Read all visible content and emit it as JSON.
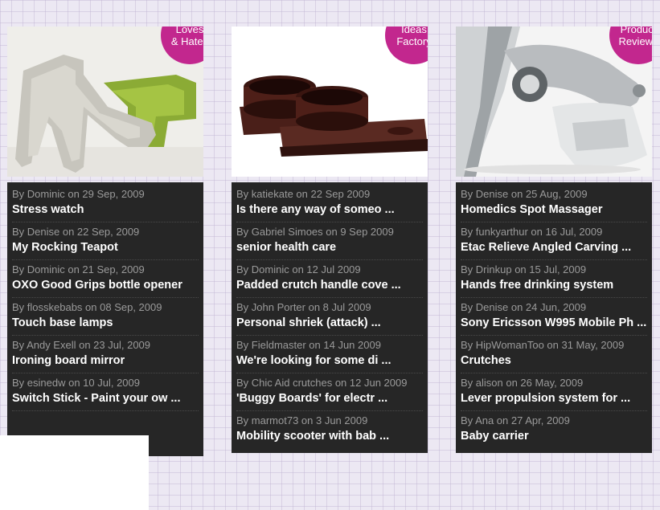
{
  "columns": [
    {
      "badge": [
        "Loves",
        "& Hates"
      ],
      "image_alt": "lounge chair",
      "items": [
        {
          "meta": "By Dominic on 29 Sep, 2009",
          "title": "Stress watch"
        },
        {
          "meta": "By Denise on 22 Sep, 2009",
          "title": "My Rocking Teapot"
        },
        {
          "meta": "By Dominic on 21 Sep, 2009",
          "title": "OXO Good Grips bottle opener"
        },
        {
          "meta": "By flosskebabs on 08 Sep, 2009",
          "title": "Touch base lamps"
        },
        {
          "meta": "By Andy Exell on 23 Jul, 2009",
          "title": "Ironing board mirror"
        },
        {
          "meta": "By esinedw on 10 Jul, 2009",
          "title": "Switch Stick - Paint your ow ..."
        }
      ]
    },
    {
      "badge": [
        "Ideas",
        "Factory"
      ],
      "image_alt": "brown cups on tray",
      "items": [
        {
          "meta": "By katiekate on 22 Sep 2009",
          "title": "Is there any way of someo ..."
        },
        {
          "meta": "By Gabriel Simoes on 9 Sep 2009",
          "title": "senior health care"
        },
        {
          "meta": "By Dominic on 12 Jul 2009",
          "title": "Padded crutch handle cove ..."
        },
        {
          "meta": "By John Porter on 8 Jul 2009",
          "title": "Personal shriek (attack) ..."
        },
        {
          "meta": "By Fieldmaster on 14 Jun 2009",
          "title": "We're looking for some di ..."
        },
        {
          "meta": "By Chic Aid crutches on 12 Jun 2009",
          "title": "'Buggy Boards' for electr ..."
        },
        {
          "meta": "By marmot73 on 3 Jun 2009",
          "title": "Mobility scooter with bab ..."
        }
      ]
    },
    {
      "badge": [
        "Product",
        "Reviews"
      ],
      "image_alt": "massager device",
      "items": [
        {
          "meta": "By Denise on 25 Aug, 2009",
          "title": "Homedics Spot Massager"
        },
        {
          "meta": "By funkyarthur on 16 Jul, 2009",
          "title": "Etac Relieve Angled Carving ..."
        },
        {
          "meta": "By Drinkup on 15 Jul, 2009",
          "title": "Hands free drinking system"
        },
        {
          "meta": "By Denise on 24 Jun, 2009",
          "title": "Sony Ericsson W995 Mobile Ph ..."
        },
        {
          "meta": "By HipWomanToo on 31 May, 2009",
          "title": "Crutches"
        },
        {
          "meta": "By alison on 26 May, 2009",
          "title": "Lever propulsion system for ..."
        },
        {
          "meta": "By Ana on 27 Apr, 2009",
          "title": "Baby carrier"
        }
      ]
    }
  ],
  "colors": {
    "badge": "#c2278e",
    "panel": "#262626",
    "meta_text": "#9a9a9a",
    "title_text": "#ffffff"
  }
}
